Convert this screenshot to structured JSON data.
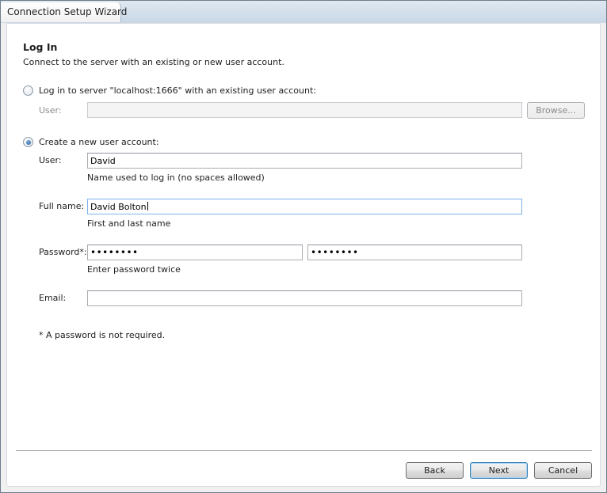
{
  "window": {
    "title": "Connection Setup Wizard"
  },
  "page": {
    "heading": "Log In",
    "subheading": "Connect to the server with an existing or new user account."
  },
  "existing_account": {
    "option_label": "Log in to server \"localhost:1666\" with an existing user account:",
    "selected": false,
    "user_label": "User:",
    "user_value": "",
    "browse_label": "Browse..."
  },
  "new_account": {
    "option_label": "Create a new user account:",
    "selected": true,
    "user_label": "User:",
    "user_value": "David",
    "user_hint": "Name used to log in (no spaces allowed)",
    "fullname_label": "Full name:",
    "fullname_value": "David Bolton",
    "fullname_hint": "First and last name",
    "password_label": "Password*:",
    "password_value": "••••••••",
    "password_confirm_value": "••••••••",
    "password_hint": "Enter password twice",
    "email_label": "Email:",
    "email_value": "",
    "footnote": "* A password is not required."
  },
  "footer": {
    "back_label": "Back",
    "next_label": "Next",
    "cancel_label": "Cancel"
  }
}
